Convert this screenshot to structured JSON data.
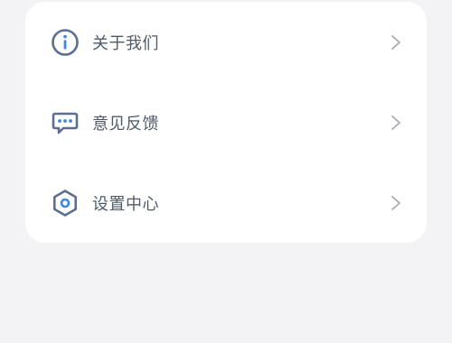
{
  "settings_card": {
    "items": [
      {
        "label": "关于我们",
        "icon": "info-icon"
      },
      {
        "label": "意见反馈",
        "icon": "feedback-icon"
      },
      {
        "label": "设置中心",
        "icon": "settings-hexagon-icon"
      }
    ]
  },
  "colors": {
    "background": "#f3f3f5",
    "card": "#ffffff",
    "icon_stroke": "#5c6f92",
    "icon_accent": "#3f86ea",
    "label": "#505b6a",
    "chevron": "#a7acb4"
  }
}
